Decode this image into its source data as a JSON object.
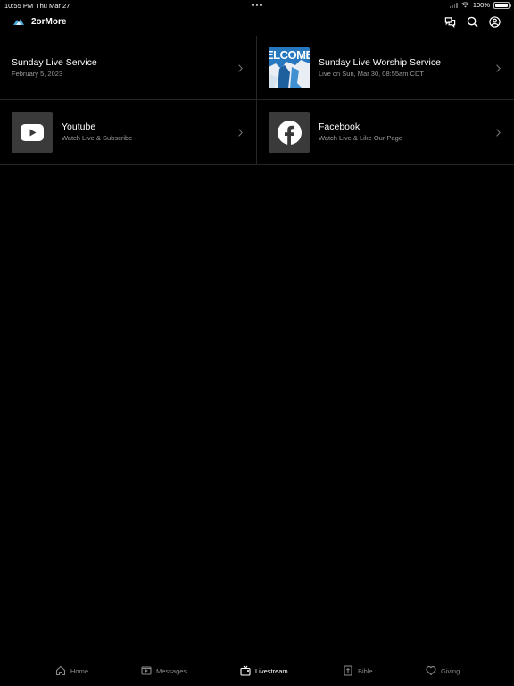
{
  "status_bar": {
    "time": "10:55 PM",
    "date": "Thu Mar 27",
    "battery": "100%"
  },
  "header": {
    "title": "2orMore"
  },
  "items": [
    {
      "title": "Sunday Live Service",
      "subtitle": "February 5, 2023"
    },
    {
      "title": "Sunday Live Worship Service",
      "subtitle": "Live on Sun, Mar 30, 08:55am CDT",
      "thumb_text": "ELCOME"
    },
    {
      "title": "Youtube",
      "subtitle": "Watch Live & Subscribe",
      "icon": "youtube-icon"
    },
    {
      "title": "Facebook",
      "subtitle": "Watch Live & Like Our Page",
      "icon": "facebook-icon"
    }
  ],
  "tabs": [
    {
      "label": "Home",
      "icon": "home-icon"
    },
    {
      "label": "Messages",
      "icon": "play-icon"
    },
    {
      "label": "Livestream",
      "icon": "tv-icon",
      "active": true
    },
    {
      "label": "Bible",
      "icon": "bible-icon"
    },
    {
      "label": "Giving",
      "icon": "heart-icon"
    }
  ],
  "colors": {
    "background": "#000000",
    "divider": "#262626",
    "subtitle": "#9a9a9a",
    "tab_inactive": "#8a8a8a",
    "thumb_blue": "#2b7cc4"
  }
}
